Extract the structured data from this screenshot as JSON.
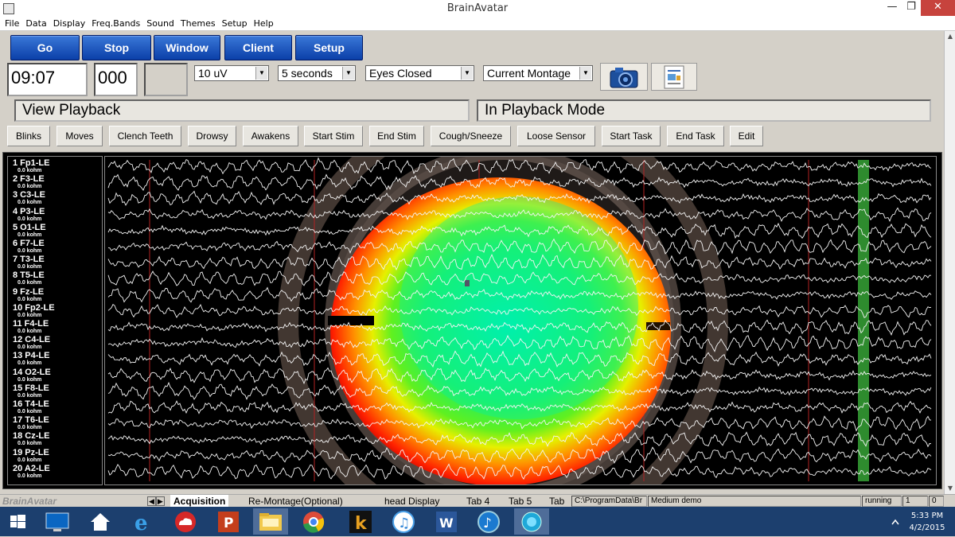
{
  "window": {
    "title": "BrainAvatar",
    "minimize": "—",
    "maximize": "❐",
    "close": "✕"
  },
  "menu": [
    "File",
    "Data",
    "Display",
    "Freq.Bands",
    "Sound",
    "Themes",
    "Setup",
    "Help"
  ],
  "toolbar": {
    "go": "Go",
    "stop": "Stop",
    "window": "Window",
    "client": "Client",
    "setup": "Setup"
  },
  "readouts": {
    "time": "09:07",
    "counter": "000",
    "blank": ""
  },
  "selects": {
    "scale": "10 uV",
    "duration": "5 seconds",
    "condition": "Eyes Closed",
    "montage": "Current Montage"
  },
  "status": {
    "left": "View Playback",
    "right": "In Playback Mode"
  },
  "events": [
    "Blinks",
    "Moves",
    "Clench Teeth",
    "Drowsy",
    "Awakens",
    "Start Stim",
    "End Stim",
    "Cough/Sneeze",
    "Loose Sensor",
    "Start Task",
    "End Task",
    "Edit"
  ],
  "channels": [
    {
      "label": "1 Fp1-LE",
      "imp": "0.0 kohm"
    },
    {
      "label": "2 F3-LE",
      "imp": "0.0 kohm"
    },
    {
      "label": "3 C3-LE",
      "imp": "0.0 kohm"
    },
    {
      "label": "4 P3-LE",
      "imp": "0.0 kohm"
    },
    {
      "label": "5 O1-LE",
      "imp": "0.0 kohm"
    },
    {
      "label": "6 F7-LE",
      "imp": "0.0 kohm"
    },
    {
      "label": "7 T3-LE",
      "imp": "0.0 kohm"
    },
    {
      "label": "8 T5-LE",
      "imp": "0.0 kohm"
    },
    {
      "label": "9 Fz-LE",
      "imp": "0.0 kohm"
    },
    {
      "label": "10 Fp2-LE",
      "imp": "0.0 kohm"
    },
    {
      "label": "11 F4-LE",
      "imp": "0.0 kohm"
    },
    {
      "label": "12 C4-LE",
      "imp": "0.0 kohm"
    },
    {
      "label": "13 P4-LE",
      "imp": "0.0 kohm"
    },
    {
      "label": "14 O2-LE",
      "imp": "0.0 kohm"
    },
    {
      "label": "15 F8-LE",
      "imp": "0.0 kohm"
    },
    {
      "label": "16 T4-LE",
      "imp": "0.0 kohm"
    },
    {
      "label": "17 T6-LE",
      "imp": "0.0 kohm"
    },
    {
      "label": "18 Cz-LE",
      "imp": "0.0 kohm"
    },
    {
      "label": "19 Pz-LE",
      "imp": "0.0 kohm"
    },
    {
      "label": "20 A2-LE",
      "imp": "0.0 kohm"
    }
  ],
  "bottom": {
    "brand": "BrainAvatar",
    "tabs": [
      "Acquisition",
      "Re-Montage(Optional)",
      "head Display",
      "Tab 4",
      "Tab 5",
      "Tab"
    ],
    "path": "C:\\ProgramData\\Br",
    "session": "Medium demo",
    "state": "running",
    "num1": "1",
    "num2": "0"
  },
  "taskbar": {
    "apps": [
      "start-icon",
      "lenovo-icon",
      "home-icon",
      "ie-icon",
      "cloud-icon",
      "powerpoint-icon",
      "file-explorer-icon",
      "chrome-icon",
      "k-app-icon",
      "itunes-icon",
      "word-icon",
      "itunes2-icon",
      "brainavatar-icon"
    ],
    "time": "5:33 PM",
    "date": "4/2/2015"
  },
  "colors": {
    "button_blue": "#0b3fa8",
    "marker_green": "#2e8b2e",
    "marker_red": "#b22222",
    "taskbar": "#1c3f6e"
  }
}
